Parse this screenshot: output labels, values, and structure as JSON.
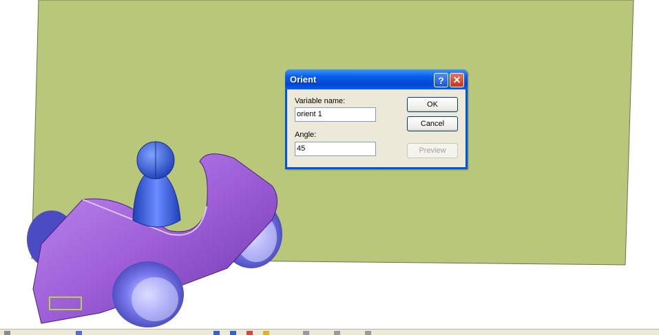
{
  "dialog": {
    "title": "Orient",
    "help_glyph": "?",
    "close_glyph": "✕",
    "variable_name_label": "Variable name:",
    "variable_name_value": "orient 1",
    "angle_label": "Angle:",
    "angle_value": "45",
    "ok_label": "OK",
    "cancel_label": "Cancel",
    "preview_label": "Preview"
  },
  "colors": {
    "plane": "#b9c77a",
    "car_body": "#9e5fd8",
    "wheels": "#5a5ad0",
    "figure": "#3a5fd0"
  },
  "icons": [
    "help-icon",
    "close-icon"
  ]
}
